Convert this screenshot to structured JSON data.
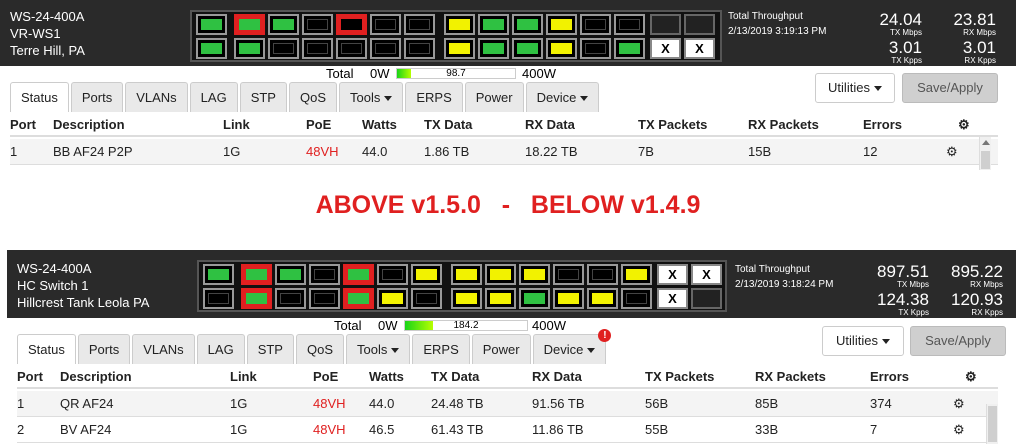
{
  "top": {
    "device": {
      "model": "WS-24-400A",
      "name": "VR-WS1",
      "location": "Terre Hill, PA"
    },
    "throughput": {
      "label": "Total Throughput",
      "timestamp": "2/13/2019 3:19:13 PM"
    },
    "stats": {
      "tx_mbps": "24.04",
      "tx_mbps_label": "TX Mbps",
      "rx_mbps": "23.81",
      "rx_mbps_label": "RX Mbps",
      "tx_kpps": "3.01",
      "tx_kpps_label": "TX Kpps",
      "rx_kpps": "3.01",
      "rx_kpps_label": "RX Kpps"
    },
    "power": {
      "label": "Total",
      "min": "0W",
      "value": "98.7",
      "max": "400W",
      "fraction": 0.12
    },
    "ports": {
      "g0": [
        "green",
        "green"
      ],
      "g1": [
        "red",
        "green",
        "green",
        "black",
        "black",
        "black",
        "red-empty",
        "black",
        "black",
        "black",
        "black",
        "black"
      ],
      "g2": [
        "yellow",
        "yellow",
        "green",
        "green",
        "green",
        "green",
        "yellow",
        "yellow",
        "black",
        "black",
        "black",
        "green"
      ],
      "sfp": [
        "sfp",
        "x",
        "sfp",
        "x"
      ]
    },
    "rows": [
      {
        "port": "1",
        "description": "BB AF24 P2P",
        "link": "1G",
        "poe": "48VH",
        "watts": "44.0",
        "tx_data": "1.86 TB",
        "rx_data": "18.22 TB",
        "tx_packets": "7B",
        "rx_packets": "15B",
        "errors": "12"
      }
    ]
  },
  "tabs": [
    {
      "label": "Status",
      "dropdown": false
    },
    {
      "label": "Ports",
      "dropdown": false
    },
    {
      "label": "VLANs",
      "dropdown": false
    },
    {
      "label": "LAG",
      "dropdown": false
    },
    {
      "label": "STP",
      "dropdown": false
    },
    {
      "label": "QoS",
      "dropdown": false
    },
    {
      "label": "Tools",
      "dropdown": true
    },
    {
      "label": "ERPS",
      "dropdown": false
    },
    {
      "label": "Power",
      "dropdown": false
    },
    {
      "label": "Device",
      "dropdown": true
    }
  ],
  "buttons": {
    "utilities": "Utilities",
    "save": "Save/Apply"
  },
  "columns": {
    "port": "Port",
    "description": "Description",
    "link": "Link",
    "poe": "PoE",
    "watts": "Watts",
    "tx_data": "TX Data",
    "rx_data": "RX Data",
    "tx_packets": "TX Packets",
    "rx_packets": "RX Packets",
    "errors": "Errors"
  },
  "banner": "ABOVE v1.5.0   -   BELOW v1.4.9",
  "bottom": {
    "device": {
      "model": "WS-24-400A",
      "name": "HC Switch 1",
      "location": "Hillcrest Tank Leola PA"
    },
    "throughput": {
      "label": "Total Throughput",
      "timestamp": "2/13/2019 3:18:24 PM"
    },
    "stats": {
      "tx_mbps": "897.51",
      "tx_mbps_label": "TX Mbps",
      "rx_mbps": "895.22",
      "rx_mbps_label": "RX Mbps",
      "tx_kpps": "124.38",
      "tx_kpps_label": "TX Kpps",
      "rx_kpps": "120.93",
      "rx_kpps_label": "RX Kpps"
    },
    "power": {
      "label": "Total",
      "min": "0W",
      "value": "184.2",
      "max": "400W",
      "fraction": 0.23
    },
    "device_badge": "!",
    "ports": {
      "g0": [
        "green",
        "black"
      ],
      "g1": [
        "red",
        "red",
        "green",
        "black",
        "black",
        "black",
        "red",
        "red",
        "black",
        "yellow",
        "yellow",
        "black"
      ],
      "g2": [
        "yellow",
        "yellow",
        "yellow",
        "yellow",
        "yellow",
        "green",
        "black",
        "yellow",
        "black",
        "yellow",
        "yellow",
        "black"
      ],
      "sfp": [
        "x",
        "x",
        "x",
        "sfp"
      ]
    },
    "rows": [
      {
        "port": "1",
        "description": "QR AF24",
        "link": "1G",
        "poe": "48VH",
        "watts": "44.0",
        "tx_data": "24.48 TB",
        "rx_data": "91.56 TB",
        "tx_packets": "56B",
        "rx_packets": "85B",
        "errors": "374"
      },
      {
        "port": "2",
        "description": "BV AF24",
        "link": "1G",
        "poe": "48VH",
        "watts": "46.5",
        "tx_data": "61.43 TB",
        "rx_data": "11.86 TB",
        "tx_packets": "55B",
        "rx_packets": "33B",
        "errors": "7"
      }
    ]
  }
}
